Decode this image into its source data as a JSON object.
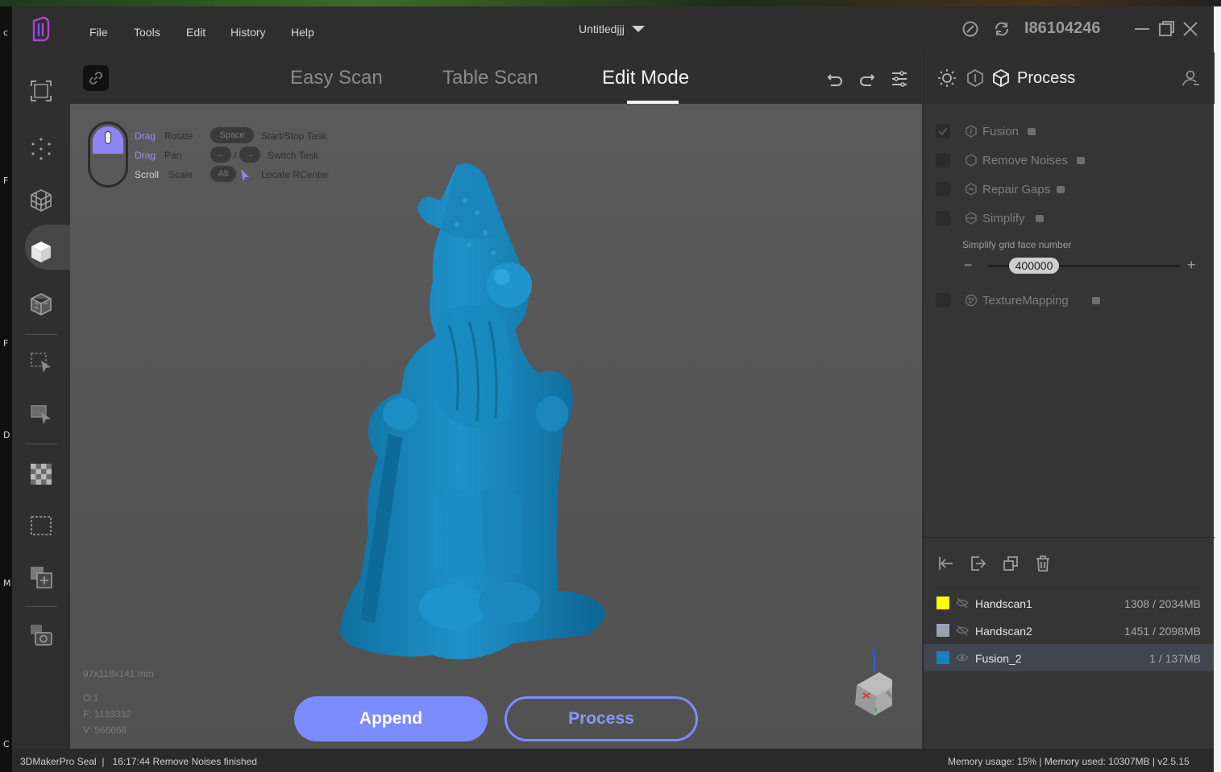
{
  "titlebar": {
    "menu": [
      "File",
      "Tools",
      "Edit",
      "History",
      "Help"
    ],
    "document_title": "Untitledjjj",
    "user_id": "I86104246",
    "icons": [
      "app-logo-icon",
      "feedback-icon",
      "sync-icon",
      "minimize-icon",
      "maximize-icon",
      "close-icon"
    ]
  },
  "tabs": [
    {
      "label": "Easy Scan",
      "active": false
    },
    {
      "label": "Table Scan",
      "active": false
    },
    {
      "label": "Edit Mode",
      "active": true
    }
  ],
  "left_toolbar": {
    "icons": [
      "fit-view-icon",
      "point-cloud-icon",
      "mesh-wireframe-icon",
      "solid-cube-icon",
      "textured-cube-icon",
      "select-region-icon",
      "select-through-icon",
      "checker-texture-icon",
      "crop-box-icon",
      "add-layer-icon",
      "texture-camera-icon"
    ],
    "active_index": 3
  },
  "hints": {
    "rows": [
      {
        "action": "Drag",
        "label": "Rotate"
      },
      {
        "action": "Drag",
        "label": "Pan"
      },
      {
        "action": "Scroll",
        "label": "Scale"
      }
    ],
    "keys": [
      {
        "key": "Space",
        "label": "Start/Stop Task"
      },
      {
        "key": "/",
        "label": "Switch Task"
      },
      {
        "key": "Alt",
        "label": "Locate RCenter"
      }
    ]
  },
  "viewport": {
    "dimensions": "97x118x141 mm",
    "stats": [
      "O:1",
      "F: 1133332",
      "V: 566668"
    ],
    "model_color": "#1d8fc6",
    "view_cube_axis": "Z",
    "view_cube_face": "RIGHT"
  },
  "buttons": {
    "append": "Append",
    "process": "Process"
  },
  "right_panel": {
    "title": "Process",
    "process_steps": [
      {
        "label": "Fusion",
        "checked": true
      },
      {
        "label": "Remove Noises",
        "checked": false
      },
      {
        "label": "Repair Gaps",
        "checked": false
      },
      {
        "label": "Simplify",
        "checked": false
      }
    ],
    "simplify": {
      "caption": "Simplify grid face number",
      "value": "400000",
      "minus": "−",
      "plus": "+"
    },
    "texture_step": {
      "label": "TextureMapping",
      "checked": false
    },
    "mesh_tools": [
      "import-icon",
      "export-icon",
      "duplicate-icon",
      "delete-icon"
    ],
    "meshes": [
      {
        "name": "Handscan1",
        "size": "1308 / 2034MB",
        "color": "#ffff00",
        "visible": false,
        "selected": false
      },
      {
        "name": "Handscan2",
        "size": "1451 / 2098MB",
        "color": "#9aa3b3",
        "visible": false,
        "selected": false
      },
      {
        "name": "Fusion_2",
        "size": "1 / 137MB",
        "color": "#1e7fb8",
        "visible": true,
        "selected": true
      }
    ]
  },
  "statusbar": {
    "left": "3DMakerPro Seal  |   16:17:44 Remove Noises finished",
    "right": "Memory usage: 15% | Memory used: 10307MB | v2.5.15"
  },
  "desktop_edge": [
    "c",
    "F",
    "F",
    "D",
    "M",
    "C"
  ],
  "accent_color": "#7c8cff"
}
